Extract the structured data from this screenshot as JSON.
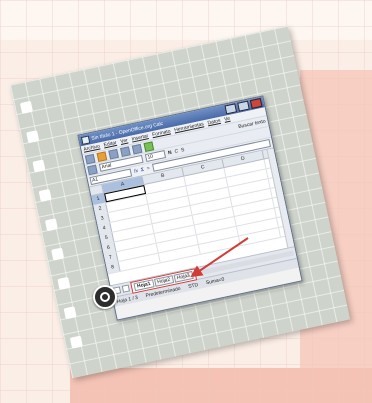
{
  "window": {
    "title": "Sin título 1 - OpenOffice.org Calc"
  },
  "menu": [
    "Archivo",
    "Editar",
    "Ver",
    "Insertar",
    "Formato",
    "Herramientas",
    "Datos",
    "Ve"
  ],
  "toolbar": {
    "search_label": "Buscar texto"
  },
  "format": {
    "font": "Arial",
    "size": "10",
    "bold": "N",
    "italic": "C",
    "underline": "S"
  },
  "formula_bar": {
    "cell_ref": "A1",
    "fx": "fx",
    "sum": "Σ",
    "equals": "="
  },
  "grid": {
    "columns": [
      "A",
      "B",
      "C",
      "D"
    ],
    "rows": [
      "1",
      "2",
      "3",
      "4",
      "5",
      "6",
      "7",
      "8"
    ]
  },
  "sheet_tabs": [
    "Hoja1",
    "Hoja2",
    "Hoja3"
  ],
  "status": {
    "page": "Hoja 1 / 3",
    "style": "Predeterminado",
    "mode": "STD",
    "sum": "Suma=0"
  },
  "colors": {
    "highlight_red": "#d23c36",
    "title_blue": "#4a6ba8"
  }
}
